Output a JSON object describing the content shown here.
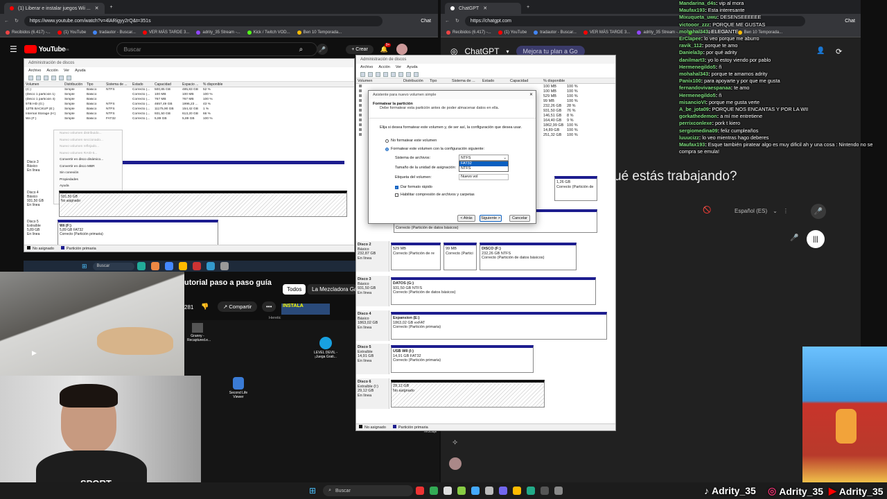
{
  "left_browser": {
    "tab_title": "(1) Liberar e instalar juegos Wii ...",
    "url": "https://www.youtube.com/watch?v=4lARigyy2rQ&t=351s",
    "chat_label": "Chat",
    "bookmarks": [
      "Recibidos (6.417) -...",
      "(1) YouTube",
      "tradautor - Buscar...",
      "VER MÁS TARDE 3...",
      "adrity_35 Stream -...",
      "Kick / Twitch VOD...",
      "Ben 10 Temporada..."
    ],
    "yt_logo": "YouTube",
    "yt_country": "ES",
    "search_placeholder": "Buscar",
    "create_label": "Crear",
    "notif_count": "9+",
    "video_title": "utorial paso a paso guía",
    "share_label": "Compartir",
    "likes": "281",
    "chip_all": "Todos",
    "chip_2": "La Mezcladora Gam",
    "tag": "Heretic",
    "thumb_label": "INSTALA"
  },
  "inner_dm": {
    "title": "Administración de discos",
    "menu": [
      "Archivo",
      "Acción",
      "Ver",
      "Ayuda"
    ],
    "cols": [
      "Volumen",
      "Distribución",
      "Tipo",
      "Sistema de ...",
      "Estado",
      "Capacidad",
      "Espacio ...",
      "% disponible"
    ],
    "rows": [
      [
        "(C:)",
        "Simple",
        "Básico",
        "NTFS",
        "Correcto (...",
        "500,85 GB",
        "485,83 GB",
        "52 %"
      ],
      [
        "(Disco 1 partición 1)",
        "Simple",
        "Básico",
        "",
        "Correcto (...",
        "100 MB",
        "100 MB",
        "100 %"
      ],
      [
        "(Disco 1 partición 4)",
        "Simple",
        "Básico",
        "",
        "Correcto (...",
        "767 MB",
        "767 MB",
        "100 %"
      ],
      [
        "5TB HD (G:)",
        "Simple",
        "Básico",
        "NTFS",
        "Correcto (...",
        "4657,49 GB",
        "1996,23 ...",
        "43 %"
      ],
      [
        "12TB BACKUP (E:)",
        "Simple",
        "Básico",
        "NTFS",
        "Correcto (...",
        "11175,90 GB",
        "154,42 GB",
        "1 %"
      ],
      [
        "Internal Storage (H:)",
        "Simple",
        "Básico",
        "NTFS",
        "Correcto (...",
        "931,50 GB",
        "613,20 GB",
        "66 %"
      ],
      [
        "Wii (F:)",
        "Simple",
        "Básico",
        "FAT32",
        "Correcto (...",
        "5,89 GB",
        "5,89 GB",
        "100 %"
      ]
    ],
    "ctx": [
      "Nuevo volumen distribuido...",
      "Nuevo volumen seccionado...",
      "Nuevo volumen reflejado...",
      "Nuevo volumen RAID-5...",
      "Convertir en disco dinámico...",
      "Convertir en disco MBR",
      "Sin conexión",
      "Propiedades",
      "Ayuda"
    ],
    "disk3": {
      "name": "Disco 3",
      "sub": "Básico",
      "state": "En línea"
    },
    "disk4": {
      "name": "Disco 4",
      "sub": "Básico",
      "size": "931,50 GB",
      "state": "En línea",
      "p_size": "931,50 GB",
      "p_state": "No asignado"
    },
    "disk5": {
      "name": "Disco 5",
      "sub": "Extraíble",
      "size": "5,89 GB",
      "state": "En línea",
      "p_name": "Wii (F:)",
      "p_size": "5,89 GB FAT32",
      "p_state": "Correcto (Partición primaria)"
    },
    "legend": [
      "No asignado",
      "Partición primaria"
    ]
  },
  "inner_taskbar": {
    "search": "Buscar"
  },
  "desktop": {
    "icon1": "Granny - Recaptured.e...",
    "icon2": "LEVEL DEVIL - ¡Juega Grati...",
    "icon3": "Second Life Viewer",
    "icon4": "reciclaje"
  },
  "right_browser": {
    "tab_title": "ChatGPT",
    "url": "https://chatgpt.com",
    "chat_label": "Chat",
    "bookmarks": [
      "Recibidos (6.417) -...",
      "(1) YouTube",
      "tradautor - Buscar...",
      "VER MÁS TARDE 3...",
      "adrity_35 Stream -...",
      "Kick / Twitch VOD...",
      "Ben 10 Temporada..."
    ],
    "app_title": "ChatGPT",
    "upgrade": "Mejora tu plan a Go",
    "prompt": "ué estás trabajando?",
    "lang": "Español (ES)"
  },
  "dm": {
    "title": "Administración de discos",
    "menu": [
      "Archivo",
      "Acción",
      "Ver",
      "Ayuda"
    ],
    "cols": [
      "Volumen",
      "Distribución",
      "Tipo",
      "Sistema de ...",
      "Estado",
      "Capacidad",
      "% disponible"
    ],
    "rows": [
      [
        "100 MB",
        "100 %"
      ],
      [
        "100 MB",
        "100 %"
      ],
      [
        "529 MB",
        "100 %"
      ],
      [
        "99 MB",
        "100 %"
      ],
      [
        "232,26 GB",
        "28 %"
      ],
      [
        "931,50 GB",
        "76 %"
      ],
      [
        "146,51 GB",
        "8 %"
      ],
      [
        "164,40 GB",
        "9 %"
      ],
      [
        "1862,99 GB",
        "100 %"
      ],
      [
        "14,89 GB",
        "100 %"
      ],
      [
        "251,32 GB",
        "100 %"
      ]
    ],
    "disk1_part": {
      "size": "1,26 GB",
      "state": "Correcto (Partición de"
    },
    "disk_row2_part": "Correcto (Partición de datos básicos)",
    "disks": [
      {
        "name": "Disco 2",
        "sub": "Básico",
        "size": "232,87 GB",
        "state": "En línea",
        "parts": [
          {
            "title": "",
            "size": "529 MB",
            "state": "Correcto (Partición de re"
          },
          {
            "title": "",
            "size": "99 MB",
            "state": "Correcto (Partici"
          },
          {
            "title": "DISCO (F:)",
            "size": "232,26 GB NTFS",
            "state": "Correcto (Partición de datos básicos)"
          }
        ]
      },
      {
        "name": "Disco 3",
        "sub": "Básico",
        "size": "931,50 GB",
        "state": "En línea",
        "parts": [
          {
            "title": "DATOS (G:)",
            "size": "931,50 GB NTFS",
            "state": "Correcto (Partición de datos básicos)"
          }
        ]
      },
      {
        "name": "Disco 4",
        "sub": "Básico",
        "size": "1863,02 GB",
        "state": "En línea",
        "parts": [
          {
            "title": "Expansion (E:)",
            "size": "1863,02 GB exFAT",
            "state": "Correcto (Partición primaria)"
          }
        ]
      },
      {
        "name": "Disco 5",
        "sub": "Extraíble",
        "size": "14,91 GB",
        "state": "En línea",
        "parts": [
          {
            "title": "USB WII (I:)",
            "size": "14,91 GB FAT32",
            "state": "Correcto (Partición primaria)"
          }
        ]
      },
      {
        "name": "Disco 6",
        "sub": "Extraíble (I:)",
        "size": "29,12 GB",
        "state": "En línea",
        "parts": [
          {
            "title": "",
            "size": "29,12 GB",
            "state": "No asignado"
          }
        ]
      }
    ],
    "legend": [
      "No asignado",
      "Partición primaria"
    ]
  },
  "wizard": {
    "title": "Asistente para nuevo volumen simple",
    "heading": "Formatear la partición",
    "subheading": "Debe formatear esta partición antes de poder almacenar datos en ella.",
    "intro": "Elija si desea formatear este volumen y, de ser así, la configuración que desea usar.",
    "opt_no": "No formatear este volumen",
    "opt_yes": "Formatear este volumen con la configuración siguiente:",
    "fs_label": "Sistema de archivos:",
    "fs_value": "NTFS",
    "fs_options": [
      "FAT32",
      "NTFS"
    ],
    "alloc_label": "Tamaño de la unidad de asignación:",
    "vol_label": "Etiqueta del volumen:",
    "vol_value": "Nuevo vol",
    "quick": "Dar formato rápido",
    "compress": "Habilitar compresión de archivos y carpetas",
    "back": "< Atrás",
    "next": "Siguiente >",
    "cancel": "Cancelar"
  },
  "chat": [
    {
      "user": "Mandarina_d4s",
      "msg": "vip al mora"
    },
    {
      "user": "Maufax193",
      "msg": "Esta interesante"
    },
    {
      "user": "Mixuqueta_uwu",
      "msg": "DESENSEEEEEE"
    },
    {
      "user": "victooor_zzz",
      "msg": "PORQUE ME GUSTAS"
    },
    {
      "user": "mohahal343",
      "msg": "ELEGANTE"
    },
    {
      "user": "ErClapee",
      "msg": "lo veo porque me aburro"
    },
    {
      "user": "ravik_112",
      "msg": "porque te amo"
    },
    {
      "user": "Daniela3p",
      "msg": "por qué adrity"
    },
    {
      "user": "danilmart3",
      "msg": "yo lo estoy viendo por pablo"
    },
    {
      "user": "Hermenegildo5",
      "msg": "ñ"
    },
    {
      "user": "mohahal343",
      "msg": "porque te amamos adrity"
    },
    {
      "user": "Panix100",
      "msg": "para apoyarte y por que me gusta"
    },
    {
      "user": "fernandovivaespanaa",
      "msg": "te amo"
    },
    {
      "user": "Hermenegildo5",
      "msg": "ñ"
    },
    {
      "user": "misancioVI",
      "msg": "porque me gusta verte"
    },
    {
      "user": "A_be_jota09",
      "msg": "PORQUE NOS ENCANTAS Y POR LA WII"
    },
    {
      "user": "gorkathedemon",
      "msg": "a mí me entretiene"
    },
    {
      "user": "perrixconlexe",
      "msg": "pork t kiero"
    },
    {
      "user": "sergiomedina09",
      "msg": "feliz cumpleaños"
    },
    {
      "user": "luuucizz",
      "msg": "lo veo mientras hago deberes"
    },
    {
      "user": "Maufax193",
      "msg": "Esque también piratear algo es muy dificil ah y una cosa : Nintendo no se compra se emula!"
    }
  ],
  "taskbar": {
    "search": "Buscar"
  },
  "socials": [
    {
      "icon": "tiktok-icon",
      "name": "Adrity_35"
    },
    {
      "icon": "instagram-icon",
      "name": "Adrity_35"
    },
    {
      "icon": "youtube-icon",
      "name": "Adrity_35"
    }
  ],
  "colors": {
    "primary_partition": "#1d1d8f",
    "yt_red": "#ff0000",
    "chat_user": "#7fe07f"
  }
}
